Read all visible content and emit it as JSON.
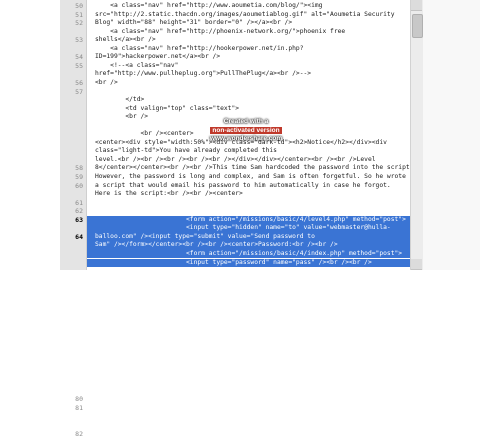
{
  "editor": {
    "line_numbers": [
      "50",
      "51",
      "52",
      "",
      "53",
      "",
      "54",
      "55",
      "",
      "56",
      "57",
      "",
      "",
      "",
      "",
      "",
      "",
      "",
      "",
      "58",
      "59",
      "60",
      "",
      "61",
      "62",
      "63",
      "",
      "64",
      "",
      "",
      "",
      "",
      "",
      "",
      "",
      "",
      "",
      "",
      "",
      "",
      "",
      "",
      "",
      "",
      "",
      "",
      "80",
      "81",
      "",
      "",
      "82",
      "",
      ""
    ],
    "lines": [
      "    <a class=\"nav\" href=\"http://www.aoumetia.com/blog/\"><img",
      "src=\"http://2.static.thacdn.org/images/aoumetiablog.gif\" alt=\"Aoumetia Security",
      "Blog\" width=\"88\" height=\"31\" border=\"0\" /></a><br />",
      "    <a class=\"nav\" href=\"http://phoenix-network.org/\">phoenix free",
      "shells</a><br />",
      "    <a class=\"nav\" href=\"http://hookerpower.net/in.php?",
      "ID=199\">hackerpower.net</a><br />",
      "    <!--<a class=\"nav\"",
      "href=\"http://www.pullheplug.org\">PullThePlug</a><br />-->",
      "<br />",
      "",
      "        </td>",
      "        <td valign=\"top\" class=\"text\">",
      "        <br />",
      "",
      "            <br /><center>",
      "<center><div style=\"width:50%\"><div class=\"dark-td\"><h2>Notice</h2></div><div",
      "class=\"light-td\">You have already completed this",
      "level.<br /><br /><br /><br /><br /></div></div></center><br /><br />Level",
      "8</center></center><br /><br />This time Sam hardcoded the password into the script.",
      "However, the password is long and complex, and Sam is often forgetful. So he wrote",
      "a script that would email his password to him automatically in case he forgot.",
      "Here is the script:<br /><br /><center>",
      "",
      "",
      "                        <form action=\"/missions/basic/4/level4.php\" method=\"post\">",
      "                        <input type=\"hidden\" name=\"to\" value=\"webmaster@hulla-",
      "balloo.com\" /><input type=\"submit\" value=\"Send password to",
      "Sam\" /></form></center><br /><br /><center>Password:<br /><br />",
      "                        <form action=\"/missions/basic/4/index.php\" method=\"post\">",
      "                        <input type=\"password\" name=\"pass\" /><br /><br />"
    ]
  },
  "watermark": {
    "line1": "Created with a",
    "line2": "non-activated version",
    "line3": "www.wondershare.com"
  }
}
